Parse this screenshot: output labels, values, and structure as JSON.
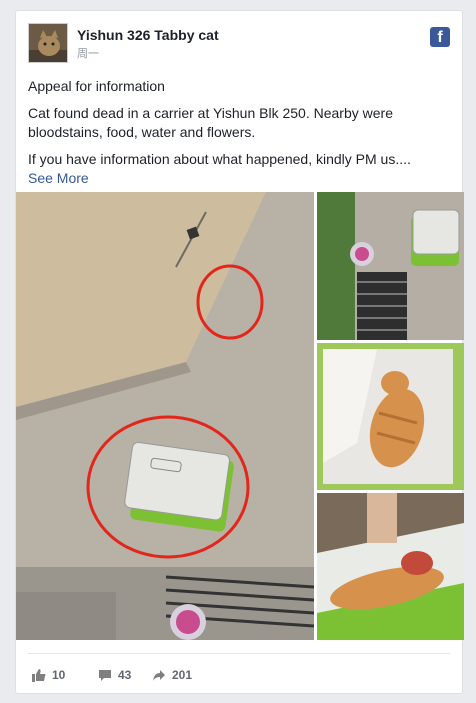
{
  "post": {
    "page_name": "Yishun 326 Tabby cat",
    "time": "周一",
    "brand_icon": "facebook-icon",
    "paragraphs": [
      "Appeal for information",
      "Cat found dead in a carrier at Yishun Blk 250. Nearby were bloodstains, food, water and flowers.",
      "If you have information about what happened, kindly PM us...."
    ],
    "see_more": "See More"
  },
  "photos": [
    {
      "icon": "carrier-by-wall-photo"
    },
    {
      "icon": "carrier-at-drain-photo"
    },
    {
      "icon": "cat-in-carrier-photo"
    },
    {
      "icon": "cat-injured-photo"
    }
  ],
  "stats": {
    "likes": "10",
    "comments": "43",
    "shares": "201"
  },
  "colors": {
    "brand": "#3b5998",
    "link": "#365899",
    "carrier_green": "#7cc133"
  }
}
